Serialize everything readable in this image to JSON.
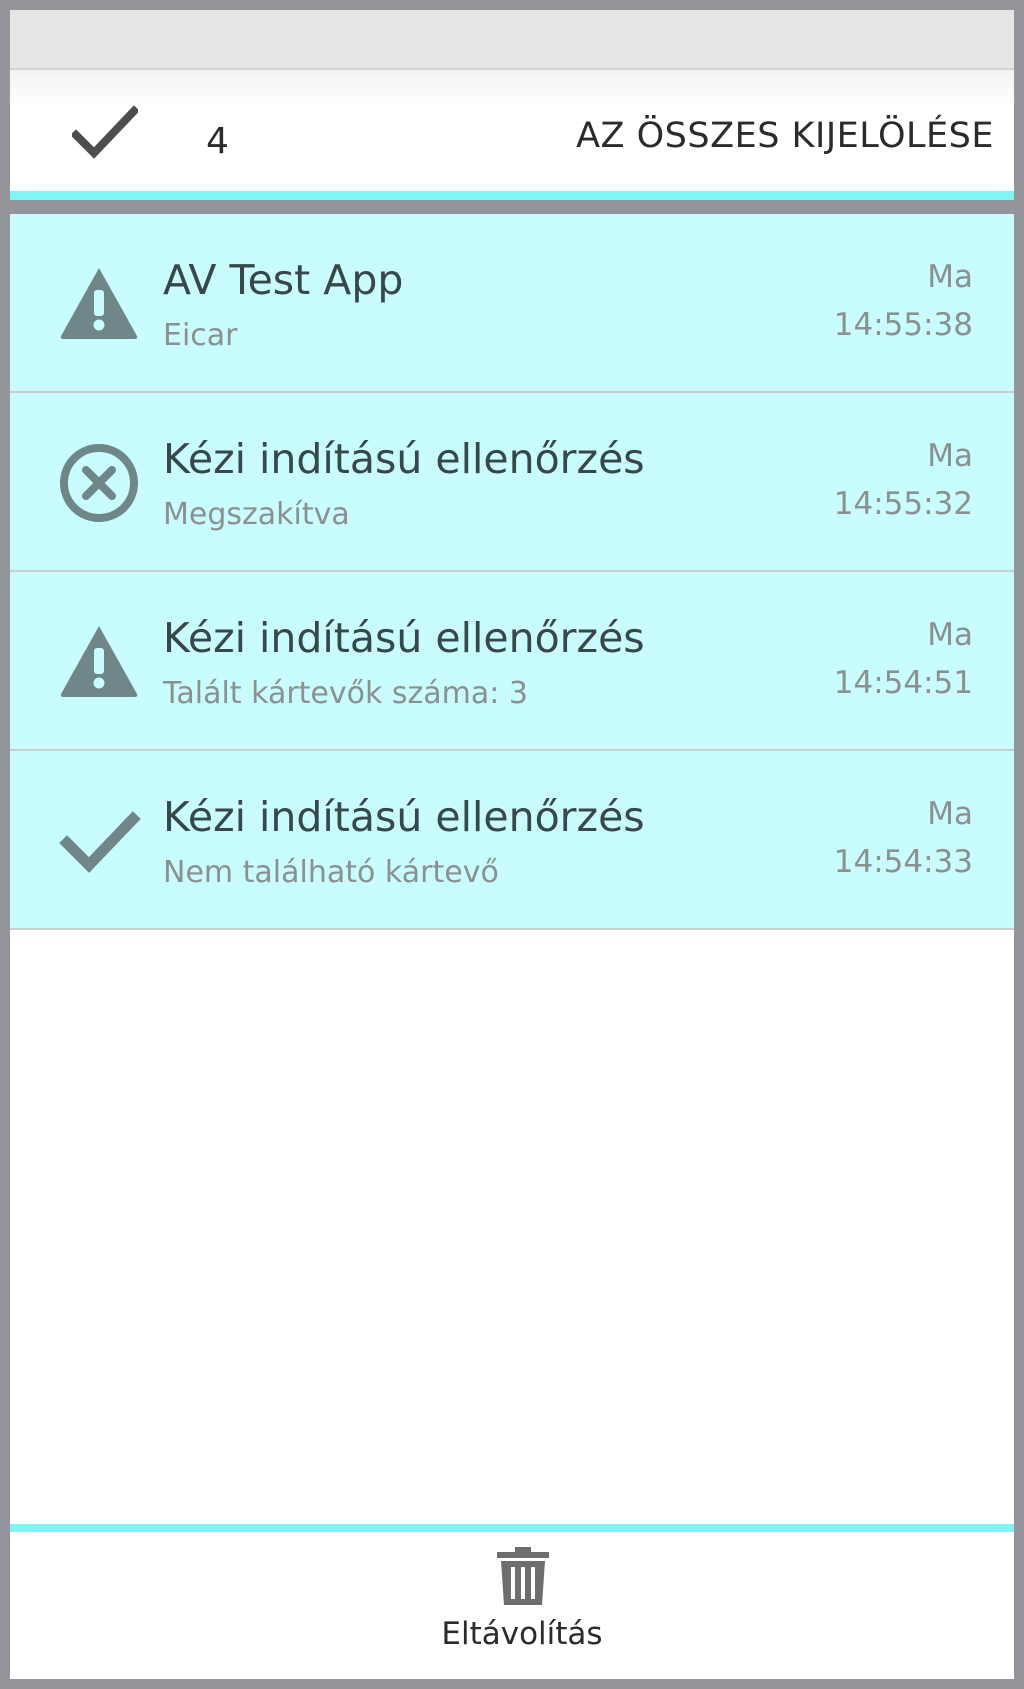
{
  "header": {
    "selected_count": "4",
    "select_all_label": "AZ ÖSSZES KIJELÖLÉSE",
    "check_icon": "check-icon"
  },
  "list": {
    "items": [
      {
        "icon": "warning-icon",
        "title": "AV Test App",
        "subtitle": "Eicar",
        "day": "Ma",
        "time": "14:55:38"
      },
      {
        "icon": "cancel-circle-icon",
        "title": "Kézi indítású ellenőrzés",
        "subtitle": "Megszakítva",
        "day": "Ma",
        "time": "14:55:32"
      },
      {
        "icon": "warning-icon",
        "title": "Kézi indítású ellenőrzés",
        "subtitle": "Talált kártevők száma: 3",
        "day": "Ma",
        "time": "14:54:51"
      },
      {
        "icon": "check-icon",
        "title": "Kézi indítású ellenőrzés",
        "subtitle": "Nem található kártevő",
        "day": "Ma",
        "time": "14:54:33"
      }
    ]
  },
  "bottom_bar": {
    "remove_label": "Eltávolítás",
    "remove_icon": "trash-icon"
  },
  "colors": {
    "accent": "#7ff6f6",
    "selected_row": "#c9fdfd",
    "icon": "#6f8788",
    "frame": "#94959a"
  }
}
